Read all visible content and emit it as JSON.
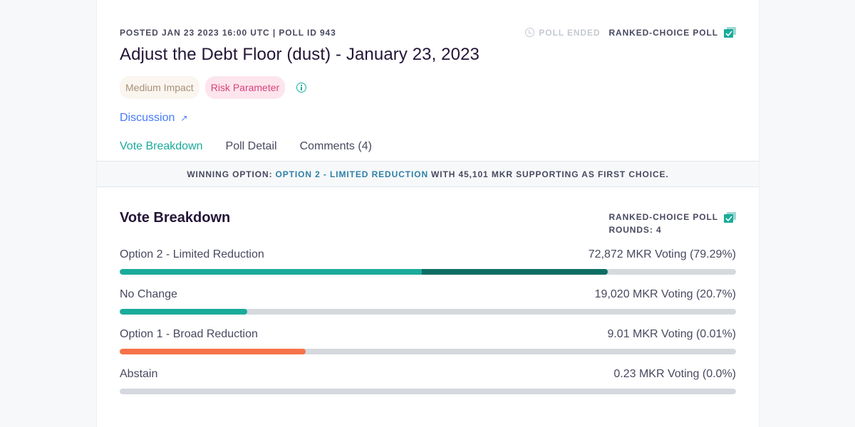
{
  "header": {
    "meta": "POSTED JAN 23 2023 16:00 UTC | POLL ID 943",
    "status": "POLL ENDED",
    "poll_type": "RANKED-CHOICE POLL",
    "title": "Adjust the Debt Floor (dust) - January 23, 2023",
    "tags": [
      "Medium Impact",
      "Risk Parameter"
    ],
    "discussion_link": "Discussion",
    "tabs": [
      "Vote Breakdown",
      "Poll Detail",
      "Comments (4)"
    ],
    "active_tab": "Vote Breakdown"
  },
  "winner": {
    "prefix": "WINNING OPTION:",
    "option": "OPTION 2 - LIMITED REDUCTION",
    "suffix": "WITH 45,101 MKR SUPPORTING AS FIRST CHOICE."
  },
  "breakdown": {
    "title": "Vote Breakdown",
    "poll_type": "RANKED-CHOICE POLL",
    "rounds": "ROUNDS: 4",
    "options": [
      {
        "name": "Option 2 - Limited Reduction",
        "result": "72,872 MKR Voting (79.29%)",
        "first_choice_fraction": 0.49,
        "transfer_fraction": 0.302
      },
      {
        "name": "No Change",
        "result": "19,020 MKR Voting (20.7%)",
        "first_choice_fraction": 0.207,
        "transfer_fraction": 0
      },
      {
        "name": "Option 1 - Broad Reduction",
        "result": "9.01 MKR Voting (0.01%)",
        "first_choice_fraction": 0.302,
        "transfer_fraction": 0
      },
      {
        "name": "Abstain",
        "result": "0.23 MKR Voting (0.0%)",
        "first_choice_fraction": 0,
        "transfer_fraction": 0
      }
    ]
  },
  "colors": {
    "accent": "#1aab9b",
    "transfer": "#0d6e64",
    "orange": "#f77249",
    "track": "#d5d9de"
  }
}
